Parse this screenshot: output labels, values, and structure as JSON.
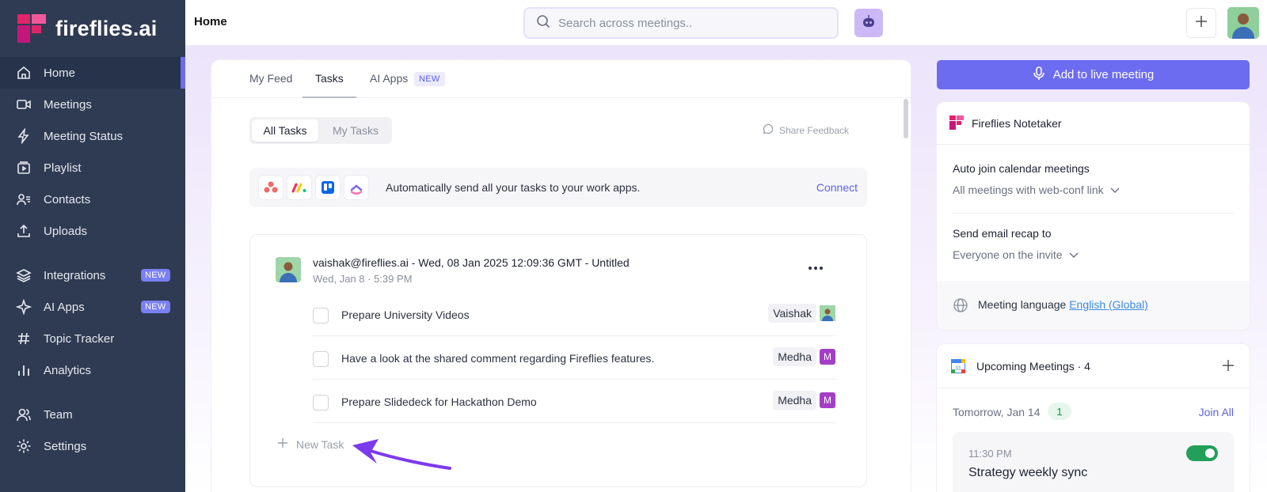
{
  "brand": {
    "name": "fireflies.ai",
    "accent": "#6c6cf0",
    "brand_pink": "#e2246b",
    "sidebar_bg": "#2f3b52"
  },
  "sidebar": {
    "items": [
      {
        "label": "Home",
        "icon": "home-icon",
        "active": true
      },
      {
        "label": "Meetings",
        "icon": "video-icon"
      },
      {
        "label": "Meeting Status",
        "icon": "lightning-icon"
      },
      {
        "label": "Playlist",
        "icon": "playlist-icon"
      },
      {
        "label": "Contacts",
        "icon": "contacts-icon"
      },
      {
        "label": "Uploads",
        "icon": "upload-icon"
      },
      {
        "label": "Integrations",
        "icon": "layers-icon",
        "badge": "NEW"
      },
      {
        "label": "AI Apps",
        "icon": "sparkle-icon",
        "badge": "NEW"
      },
      {
        "label": "Topic Tracker",
        "icon": "hash-icon"
      },
      {
        "label": "Analytics",
        "icon": "bar-chart-icon"
      },
      {
        "label": "Team",
        "icon": "team-icon"
      },
      {
        "label": "Settings",
        "icon": "gear-icon"
      }
    ]
  },
  "header": {
    "title": "Home",
    "search_placeholder": "Search across meetings.."
  },
  "tabs": {
    "feed": "My Feed",
    "tasks": "Tasks",
    "ai_apps": "AI Apps",
    "ai_apps_badge": "NEW"
  },
  "filters": {
    "all": "All Tasks",
    "mine": "My Tasks"
  },
  "feedback_label": "Share Feedback",
  "connect": {
    "apps": [
      "asana-icon",
      "monday-icon",
      "trello-icon",
      "clickup-icon"
    ],
    "text": "Automatically send all your tasks to your work apps.",
    "link": "Connect"
  },
  "meeting": {
    "title": "vaishak@fireflies.ai - Wed, 08 Jan 2025 12:09:36 GMT - Untitled",
    "subtitle": "Wed, Jan 8 · 5:39 PM"
  },
  "tasks": [
    {
      "text": "Prepare University Videos",
      "assignee": "Vaishak",
      "avatar": "photo"
    },
    {
      "text": "Have a look at the shared comment regarding Fireflies features.",
      "assignee": "Medha",
      "avatar": "M"
    },
    {
      "text": "Prepare Slidedeck for Hackathon Demo",
      "assignee": "Medha",
      "avatar": "M"
    }
  ],
  "new_task_label": "New Task",
  "live_button": "Add to live meeting",
  "notetaker": {
    "title": "Fireflies Notetaker",
    "auto_join_label": "Auto join calendar meetings",
    "auto_join_value": "All meetings with web-conf link",
    "recap_label": "Send email recap to",
    "recap_value": "Everyone on the invite",
    "language_label": "Meeting language",
    "language_value": "English (Global)"
  },
  "upcoming": {
    "title": "Upcoming Meetings · 4",
    "date": "Tomorrow, Jan 14",
    "count": "1",
    "join_all": "Join All",
    "meeting_time": "11:30 PM",
    "meeting_name": "Strategy weekly sync",
    "record_enabled": true
  }
}
